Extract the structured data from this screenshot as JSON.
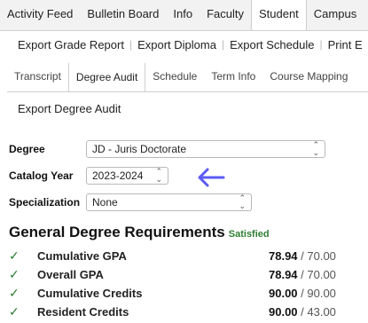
{
  "top_tabs": [
    "Activity Feed",
    "Bulletin Board",
    "Info",
    "Faculty",
    "Student",
    "Campus"
  ],
  "active_top_tab": "Student",
  "sub_links": [
    "Export Grade Report",
    "Export Diploma",
    "Export Schedule",
    "Print E"
  ],
  "sub_tabs": [
    "Transcript",
    "Degree Audit",
    "Schedule",
    "Term Info",
    "Course Mapping"
  ],
  "active_sub_tab": "Degree Audit",
  "export_audit_label": "Export Degree Audit",
  "form": {
    "degree_label": "Degree",
    "degree_value": "JD - Juris Doctorate",
    "catalog_label": "Catalog Year",
    "catalog_value": "2023-2024",
    "specialization_label": "Specialization",
    "specialization_value": "None"
  },
  "section": {
    "title": "General Degree Requirements",
    "status": "Satisfied"
  },
  "requirements": [
    {
      "name": "Cumulative GPA",
      "value": "78.94",
      "required": " / 70.00"
    },
    {
      "name": "Overall GPA",
      "value": "78.94",
      "required": " / 70.00"
    },
    {
      "name": "Cumulative Credits",
      "value": "90.00",
      "required": " / 90.00"
    },
    {
      "name": "Resident Credits",
      "value": "90.00",
      "required": " / 43.00"
    }
  ],
  "colors": {
    "arrow": "#5b5bf5",
    "satisfied": "#2e7d32"
  },
  "icons": {
    "check": "check-icon",
    "arrow": "arrow-left-icon",
    "caret": "updown-caret-icon"
  }
}
